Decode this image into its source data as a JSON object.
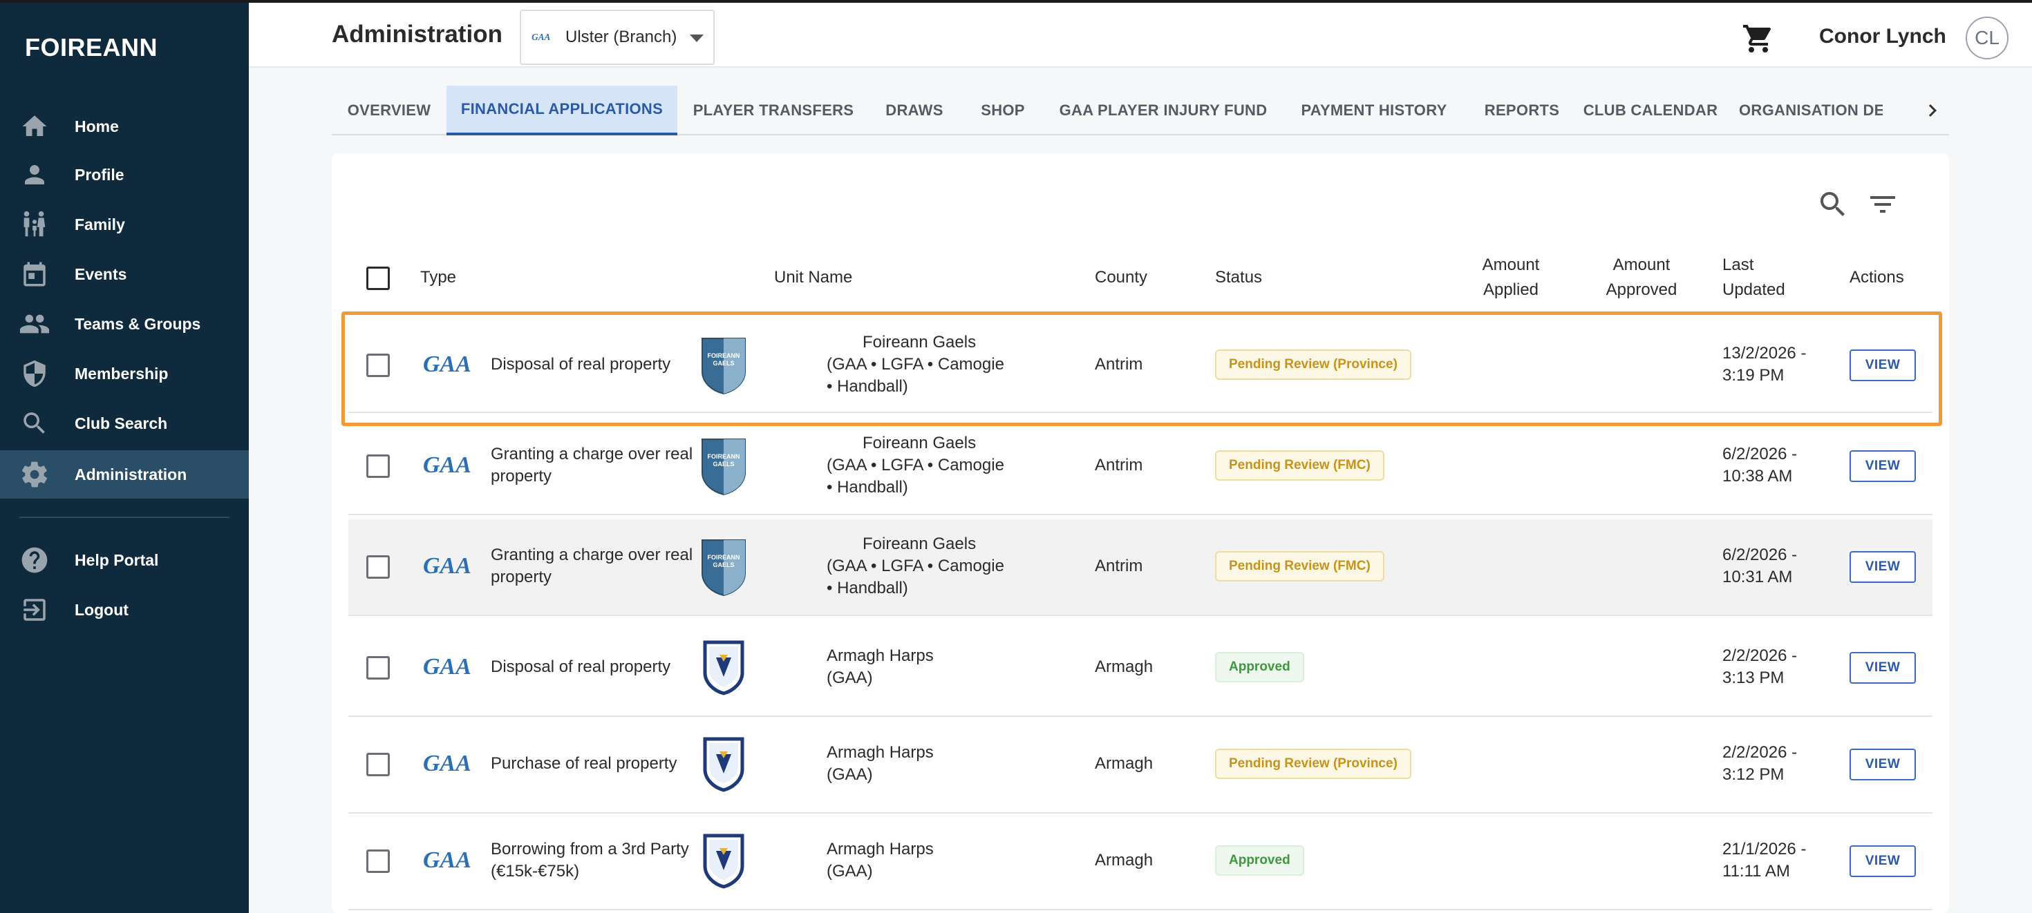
{
  "sidebar": {
    "brand": "FOIREANN",
    "items": [
      {
        "label": "Home",
        "icon": "home-icon"
      },
      {
        "label": "Profile",
        "icon": "person-icon"
      },
      {
        "label": "Family",
        "icon": "family-icon"
      },
      {
        "label": "Events",
        "icon": "calendar-icon"
      },
      {
        "label": "Teams & Groups",
        "icon": "people-icon"
      },
      {
        "label": "Membership",
        "icon": "shield-icon"
      },
      {
        "label": "Club Search",
        "icon": "search-icon"
      },
      {
        "label": "Administration",
        "icon": "gear-icon",
        "active": true
      },
      {
        "label": "Help Portal",
        "icon": "help-icon"
      },
      {
        "label": "Logout",
        "icon": "logout-icon"
      }
    ]
  },
  "header": {
    "title": "Administration",
    "branch": "Ulster (Branch)",
    "user_name": "Conor Lynch",
    "user_initials": "CL"
  },
  "tabs": [
    "OVERVIEW",
    "FINANCIAL APPLICATIONS",
    "PLAYER TRANSFERS",
    "DRAWS",
    "SHOP",
    "GAA PLAYER INJURY FUND",
    "PAYMENT HISTORY",
    "REPORTS",
    "CLUB CALENDAR",
    "ORGANISATION DETA"
  ],
  "active_tab": "FINANCIAL APPLICATIONS",
  "table": {
    "columns": {
      "type": "Type",
      "unit_name": "Unit Name",
      "county": "County",
      "status": "Status",
      "amount_applied_1": "Amount",
      "amount_applied_2": "Applied",
      "amount_approved_1": "Amount",
      "amount_approved_2": "Approved",
      "last_updated_1": "Last",
      "last_updated_2": "Updated",
      "actions": "Actions"
    },
    "view_label": "VIEW",
    "rows": [
      {
        "type": "Disposal of real property",
        "unit_line1": "Foireann Gaels",
        "unit_line2": "(GAA • LGFA • Camogie",
        "unit_line3": "• Handball)",
        "crest_text": "FOIREANN GAELS",
        "county": "Antrim",
        "status": "Pending Review (Province)",
        "status_kind": "pending",
        "date": "13/2/2026 -",
        "time": "3:19 PM"
      },
      {
        "type_line1": "Granting a charge over real",
        "type_line2": "property",
        "unit_line1": "Foireann Gaels",
        "unit_line2": "(GAA • LGFA • Camogie",
        "unit_line3": "• Handball)",
        "crest_text": "FOIREANN GAELS",
        "county": "Antrim",
        "status": "Pending Review (FMC)",
        "status_kind": "pending",
        "date": "6/2/2026 -",
        "time": "10:38 AM"
      },
      {
        "type_line1": "Granting a charge over real",
        "type_line2": "property",
        "unit_line1": "Foireann Gaels",
        "unit_line2": "(GAA • LGFA • Camogie",
        "unit_line3": "• Handball)",
        "crest_text": "FOIREANN GAELS",
        "county": "Antrim",
        "status": "Pending Review (FMC)",
        "status_kind": "pending",
        "date": "6/2/2026 -",
        "time": "10:31 AM"
      },
      {
        "type": "Disposal of real property",
        "unit_line1": "Armagh Harps",
        "unit_line2": "(GAA)",
        "county": "Armagh",
        "status": "Approved",
        "status_kind": "approved",
        "date": "2/2/2026 -",
        "time": "3:13 PM"
      },
      {
        "type": "Purchase of real property",
        "unit_line1": "Armagh Harps",
        "unit_line2": "(GAA)",
        "county": "Armagh",
        "status": "Pending Review (Province)",
        "status_kind": "pending",
        "date": "2/2/2026 -",
        "time": "3:12 PM"
      },
      {
        "type_line1": "Borrowing from a 3rd Party",
        "type_line2": "(€15k-€75k)",
        "unit_line1": "Armagh Harps",
        "unit_line2": "(GAA)",
        "county": "Armagh",
        "status": "Approved",
        "status_kind": "approved",
        "date": "21/1/2026 -",
        "time": "11:11 AM"
      }
    ]
  },
  "colors": {
    "sidebar_bg": "#0f2a3d",
    "sidebar_active": "#2a4d68",
    "accent_blue": "#2a5aa8",
    "highlight_orange": "#f29a3a",
    "pending": "#c8931a",
    "approved": "#3c9a3c"
  }
}
